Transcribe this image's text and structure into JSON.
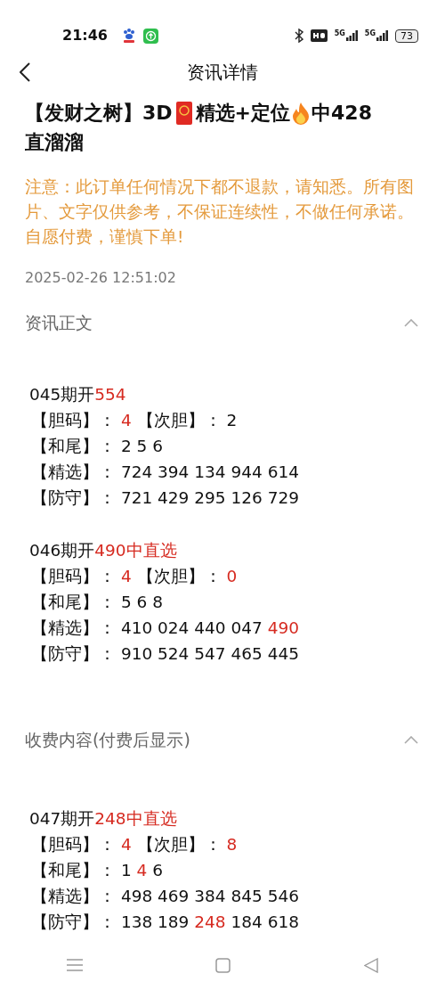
{
  "status_bar": {
    "time": "21:46",
    "signals": [
      "5G",
      "5G"
    ],
    "battery": "73"
  },
  "header": {
    "title": "资讯详情"
  },
  "article": {
    "title_parts": [
      {
        "kind": "text",
        "text": "【发财之树】3D"
      },
      {
        "kind": "envelope"
      },
      {
        "kind": "text",
        "text": "精选+定位"
      },
      {
        "kind": "fire"
      },
      {
        "kind": "text",
        "text": "中428"
      },
      {
        "kind": "text",
        "text": "直溜溜"
      }
    ],
    "notice": "注意：此订单任何情况下都不退款，请知悉。所有图片、文字仅供参考，不保证连续性，不做任何承诺。自愿付费，谨慎下单!",
    "date": "2025-02-26 12:51:02"
  },
  "sections": [
    {
      "heading": "资讯正文",
      "expanded": true,
      "blocks": [
        {
          "lines": [
            [
              {
                "text": "045期开",
                "highlight": false
              },
              {
                "text": "554",
                "highlight": true
              }
            ],
            [
              {
                "text": "【胆码】： ",
                "highlight": false
              },
              {
                "text": "4",
                "highlight": true
              },
              {
                "text": " 【次胆】： 2",
                "highlight": false
              }
            ],
            [
              {
                "text": "【和尾】： 2 5 6",
                "highlight": false
              }
            ],
            [
              {
                "text": "【精选】： 724 394 134 944 614",
                "highlight": false
              }
            ],
            [
              {
                "text": "【防守】： 721 429 295 126 729",
                "highlight": false
              }
            ]
          ]
        },
        {
          "lines": [
            [
              {
                "text": "046期开",
                "highlight": false
              },
              {
                "text": "490中直选",
                "highlight": true
              }
            ],
            [
              {
                "text": "【胆码】： ",
                "highlight": false
              },
              {
                "text": "4",
                "highlight": true
              },
              {
                "text": " 【次胆】： ",
                "highlight": false
              },
              {
                "text": "0",
                "highlight": true
              }
            ],
            [
              {
                "text": "【和尾】： 5 6 8",
                "highlight": false
              }
            ],
            [
              {
                "text": "【精选】： 410 024 440 047 ",
                "highlight": false
              },
              {
                "text": "490",
                "highlight": true
              }
            ],
            [
              {
                "text": "【防守】： 910 524 547 465 445",
                "highlight": false
              }
            ]
          ]
        }
      ]
    },
    {
      "heading": "收费内容(付费后显示)",
      "expanded": true,
      "blocks": [
        {
          "lines": [
            [
              {
                "text": "047期开",
                "highlight": false
              },
              {
                "text": "248中直选",
                "highlight": true
              }
            ],
            [
              {
                "text": "【胆码】： ",
                "highlight": false
              },
              {
                "text": "4",
                "highlight": true
              },
              {
                "text": " 【次胆】： ",
                "highlight": false
              },
              {
                "text": "8",
                "highlight": true
              }
            ],
            [
              {
                "text": "【和尾】： 1 ",
                "highlight": false
              },
              {
                "text": "4",
                "highlight": true
              },
              {
                "text": " 6",
                "highlight": false
              }
            ],
            [
              {
                "text": "【精选】： 498 469 384 845 546",
                "highlight": false
              }
            ],
            [
              {
                "text": "【防守】： 138 189 ",
                "highlight": false
              },
              {
                "text": "248",
                "highlight": true
              },
              {
                "text": " 184 618",
                "highlight": false
              }
            ]
          ]
        }
      ]
    }
  ]
}
